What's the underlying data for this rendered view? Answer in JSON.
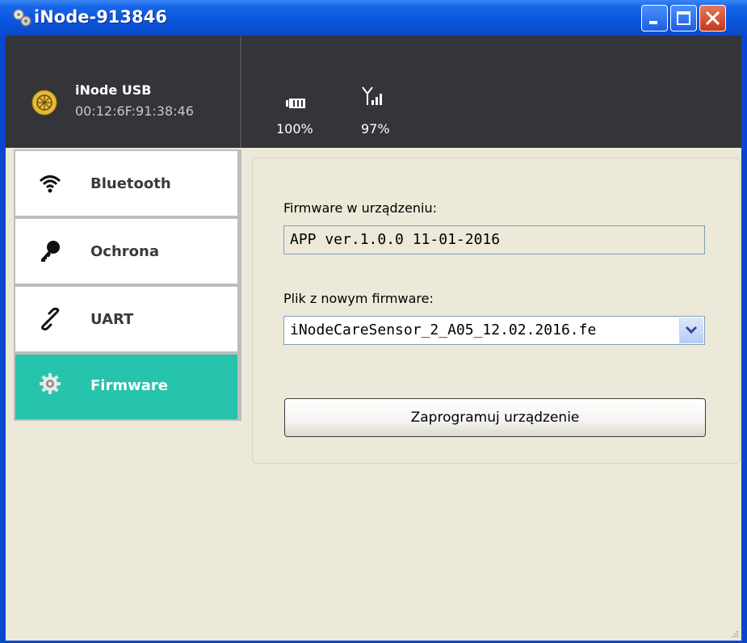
{
  "window": {
    "title": "iNode-913846"
  },
  "header": {
    "device_name": "iNode USB",
    "device_mac": "00:12:6F:91:38:46",
    "battery": {
      "icon": "battery-icon",
      "value": "100%"
    },
    "signal": {
      "icon": "signal-icon",
      "value": "97%"
    }
  },
  "sidebar": {
    "items": [
      {
        "label": "Bluetooth",
        "icon": "wifi-icon",
        "active": false
      },
      {
        "label": "Ochrona",
        "icon": "key-icon",
        "active": false
      },
      {
        "label": "UART",
        "icon": "link-icon",
        "active": false
      },
      {
        "label": "Firmware",
        "icon": "gear-icon",
        "active": true
      }
    ]
  },
  "firmware": {
    "current_label": "Firmware w urządzeniu:",
    "current_value": "APP ver.1.0.0  11-01-2016",
    "new_label": "Plik z nowym firmware:",
    "new_value": "iNodeCareSensor_2_A05_12.02.2016.fe",
    "program_button": "Zaprogramuj urządzenie"
  },
  "colors": {
    "header_bg": "#333538",
    "accent": "#26c3ad",
    "titlebar": "#0a55dd"
  }
}
